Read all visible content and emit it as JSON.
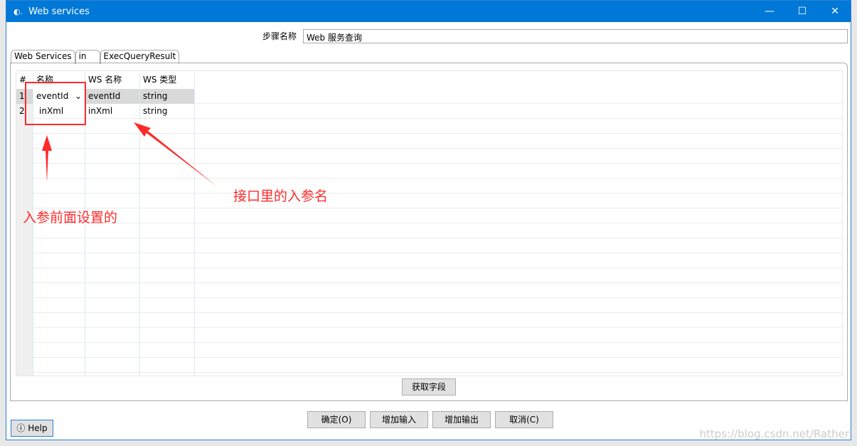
{
  "window": {
    "title": "Web services",
    "icon": "app-icon"
  },
  "step": {
    "label": "步骤名称",
    "value": "Web 服务查询"
  },
  "tabs": [
    {
      "label": "Web Services"
    },
    {
      "label": "in"
    },
    {
      "label": "ExecQueryResult"
    }
  ],
  "grid": {
    "headers": [
      "#",
      "名称",
      "WS 名称",
      "WS 类型"
    ],
    "rows": [
      {
        "num": "1",
        "name": "eventId",
        "ws_name": "eventId",
        "ws_type": "string"
      },
      {
        "num": "2",
        "name": "inXml",
        "ws_name": "inXml",
        "ws_type": "string"
      }
    ]
  },
  "buttons": {
    "get_fields": "获取字段",
    "ok": "确定(O)",
    "add_input": "增加输入",
    "add_output": "增加输出",
    "cancel": "取消(C)",
    "help": "Help"
  },
  "annotations": {
    "left": "入参前面设置的",
    "right": "接口里的入参名",
    "color": "#ff2a2a"
  },
  "watermark": "https://blog.csdn.net/Rather"
}
